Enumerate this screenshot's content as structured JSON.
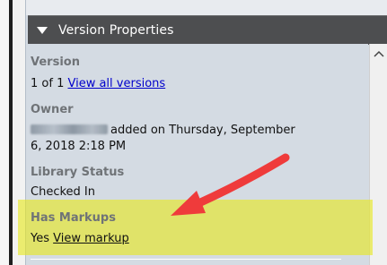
{
  "panel": {
    "title": "Version Properties"
  },
  "fields": {
    "version": {
      "label": "Version",
      "value_prefix": "1 of 1",
      "link": "View all versions"
    },
    "owner": {
      "label": "Owner",
      "value_line1": "added on Thursday, September",
      "value_line2": "6, 2018 2:18 PM"
    },
    "library_status": {
      "label": "Library Status",
      "value": "Checked In"
    },
    "has_markups": {
      "label": "Has Markups",
      "value_prefix": "Yes",
      "link": "View markup"
    }
  },
  "colors": {
    "header_bg": "#4d4e50",
    "panel_bg": "#d4dbe3",
    "highlight": "#e6e81e",
    "arrow": "#ef3b3b",
    "link": "#0000cc"
  },
  "icons": {
    "collapse": "triangle-down-icon",
    "scroll_up": "chevron-up-icon",
    "annotation": "red-arrow-annotation"
  }
}
